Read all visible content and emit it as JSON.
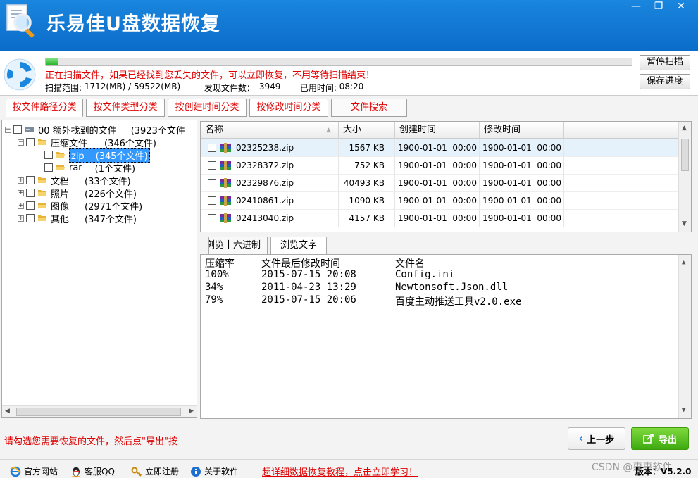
{
  "app": {
    "title": "乐易佳U盘数据恢复"
  },
  "window_controls": {
    "minimize": "—",
    "restore": "❐",
    "close": "✕"
  },
  "scan": {
    "progress_percent": 2,
    "message": "正在扫描文件，如果已经找到您丢失的文件，可以立即恢复，不用等待扫描结束！",
    "range_label": "扫描范围: ",
    "range_value": "1712(MB) / 59522(MB)",
    "found_label": "发现文件数：",
    "found_value": "3949",
    "time_label": "已用时间: ",
    "time_value": "08:20",
    "pause_label": "暂停扫描",
    "save_label": "保存进度"
  },
  "tabs": [
    {
      "label": "按文件路径分类"
    },
    {
      "label": "按文件类型分类"
    },
    {
      "label": "按创建时间分类"
    },
    {
      "label": "按修改时间分类"
    },
    {
      "label": "文件搜索"
    }
  ],
  "tree": [
    {
      "label": "00  额外找到的文件",
      "count": "(3923个文件"
    },
    {
      "label": "压缩文件",
      "count": "(346个文件)"
    },
    {
      "label": "zip",
      "count": "(345个文件)"
    },
    {
      "label": "rar",
      "count": "(1个文件)"
    },
    {
      "label": "文档",
      "count": "(33个文件)"
    },
    {
      "label": "照片",
      "count": "(226个文件)"
    },
    {
      "label": "图像",
      "count": "(2971个文件)"
    },
    {
      "label": "其他",
      "count": "(347个文件)"
    }
  ],
  "file_list": {
    "columns": [
      "名称",
      "大小",
      "创建时间",
      "修改时间"
    ],
    "rows": [
      {
        "name": "02325238.zip",
        "size": "1567 KB",
        "created": "1900-01-01  00:00",
        "modified": "1900-01-01  00:00"
      },
      {
        "name": "02328372.zip",
        "size": "752 KB",
        "created": "1900-01-01  00:00",
        "modified": "1900-01-01  00:00"
      },
      {
        "name": "02329876.zip",
        "size": "40493 KB",
        "created": "1900-01-01  00:00",
        "modified": "1900-01-01  00:00"
      },
      {
        "name": "02410861.zip",
        "size": "1090 KB",
        "created": "1900-01-01  00:00",
        "modified": "1900-01-01  00:00"
      },
      {
        "name": "02413040.zip",
        "size": "4157 KB",
        "created": "1900-01-01  00:00",
        "modified": "1900-01-01  00:00"
      }
    ]
  },
  "preview": {
    "tabs": [
      "浏览十六进制",
      "浏览文字"
    ],
    "header": [
      "压缩率",
      "文件最后修改时间",
      "文件名"
    ],
    "rows": [
      [
        "100%",
        "2015-07-15 20:08",
        "Config.ini"
      ],
      [
        "34%",
        "2011-04-23 13:29",
        "Newtonsoft.Json.dll"
      ],
      [
        "79%",
        "2015-07-15 20:06",
        "百度主动推送工具v2.0.exe"
      ]
    ]
  },
  "hint": "请勾选您需要恢复的文件，然后点\"导出\"按",
  "nav": {
    "prev_label": "上一步",
    "export_label": "导出"
  },
  "footer": {
    "links": [
      "官方网站",
      "客服QQ",
      "立即注册",
      "关于软件"
    ],
    "promo": "超详细数据恢复教程，点击立即学习！",
    "version_label": "版本：",
    "version_value": "V5.2.0"
  },
  "watermark": "CSDN @惠惠软件",
  "colors": {
    "title_bar": "#0b6cc9",
    "alert_red": "#e00000",
    "export_green": "#3daa10",
    "selection_blue": "#3399ff"
  }
}
